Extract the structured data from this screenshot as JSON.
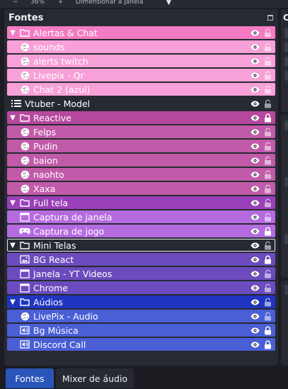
{
  "toolbar": {
    "minus": "−",
    "zoom": "36%",
    "plus": "+",
    "resize": "Dimensionar à janela",
    "caret": "▼"
  },
  "panel": {
    "title": "Fontes"
  },
  "edge_panel_letter": "C",
  "sources": [
    {
      "label": "Alertas & Chat",
      "type": "group",
      "expanded": true,
      "level": 0,
      "icon": "folder-icon",
      "bg": "#f47bc3",
      "visible": true,
      "locked": false
    },
    {
      "label": "sounds",
      "type": "item",
      "level": 1,
      "icon": "browser-globe-icon",
      "bg": "#f8a0d8",
      "visible": true,
      "locked": false
    },
    {
      "label": "alerts twitch",
      "type": "item",
      "level": 1,
      "icon": "browser-globe-icon",
      "bg": "#f8a0d8",
      "visible": true,
      "locked": false
    },
    {
      "label": "Livepix - Qr",
      "type": "item",
      "level": 1,
      "icon": "browser-globe-icon",
      "bg": "#f8a0d8",
      "visible": true,
      "locked": false
    },
    {
      "label": "Chat 2 (azul)",
      "type": "item",
      "level": 1,
      "icon": "browser-globe-icon",
      "bg": "#f8a0d8",
      "visible": true,
      "locked": false
    },
    {
      "label": "Vtuber - Model",
      "type": "item",
      "level": 0,
      "icon": "list-icon",
      "bg": "#272a33",
      "visible": true,
      "locked": false
    },
    {
      "label": "Reactive",
      "type": "group",
      "expanded": true,
      "level": 0,
      "icon": "folder-icon",
      "bg": "#b6489e",
      "visible": true,
      "locked": true
    },
    {
      "label": "Felps",
      "type": "item",
      "level": 1,
      "icon": "browser-globe-icon",
      "bg": "#c15ba9",
      "visible": true,
      "locked": false
    },
    {
      "label": "Pudin",
      "type": "item",
      "level": 1,
      "icon": "browser-globe-icon",
      "bg": "#c15ba9",
      "visible": true,
      "locked": false
    },
    {
      "label": "baion",
      "type": "item",
      "level": 1,
      "icon": "browser-globe-icon",
      "bg": "#c15ba9",
      "visible": true,
      "locked": false
    },
    {
      "label": "naohto",
      "type": "item",
      "level": 1,
      "icon": "browser-globe-icon",
      "bg": "#c15ba9",
      "visible": true,
      "locked": false
    },
    {
      "label": "Xaxa",
      "type": "item",
      "level": 1,
      "icon": "browser-globe-icon",
      "bg": "#c15ba9",
      "visible": true,
      "locked": false
    },
    {
      "label": "Full tela",
      "type": "group",
      "expanded": true,
      "level": 0,
      "icon": "folder-icon",
      "bg": "#9a40b8",
      "visible": true,
      "locked": false
    },
    {
      "label": "Captura de janela",
      "type": "item",
      "level": 1,
      "icon": "window-capture-icon",
      "bg": "#b56be0",
      "visible": true,
      "locked": false
    },
    {
      "label": "Captura de jogo",
      "type": "item",
      "level": 1,
      "icon": "gamepad-icon",
      "bg": "#b56be0",
      "visible": true,
      "locked": true
    },
    {
      "label": "Mini Telas",
      "type": "group",
      "expanded": true,
      "level": 0,
      "icon": "folder-icon",
      "bg": "#272a33",
      "visible": true,
      "locked": false,
      "selected": true
    },
    {
      "label": "BG React",
      "type": "item",
      "level": 1,
      "icon": "image-icon",
      "bg": "#6b4bbd",
      "visible": true,
      "locked": true
    },
    {
      "label": "Janela - YT Videos",
      "type": "item",
      "level": 1,
      "icon": "window-capture-icon",
      "bg": "#6b4bbd",
      "visible": true,
      "locked": false
    },
    {
      "label": "Chrome",
      "type": "item",
      "level": 1,
      "icon": "window-capture-icon",
      "bg": "#6b4bbd",
      "visible": true,
      "locked": false
    },
    {
      "label": "Aúdios",
      "type": "group",
      "expanded": true,
      "level": 0,
      "icon": "folder-icon",
      "bg": "#1f35c0",
      "visible": true,
      "locked": false
    },
    {
      "label": "LivePix - Audio",
      "type": "item",
      "level": 1,
      "icon": "browser-globe-icon",
      "bg": "#4a5ed6",
      "visible": true,
      "locked": false
    },
    {
      "label": "Bg Música",
      "type": "item",
      "level": 1,
      "icon": "audio-icon",
      "bg": "#4a5ed6",
      "visible": true,
      "locked": true
    },
    {
      "label": "Discord Call",
      "type": "item",
      "level": 1,
      "icon": "audio-icon",
      "bg": "#4a5ed6",
      "visible": true,
      "locked": true
    }
  ],
  "tabs": [
    {
      "label": "Fontes",
      "active": true
    },
    {
      "label": "Mixer de áudio",
      "active": false
    }
  ]
}
